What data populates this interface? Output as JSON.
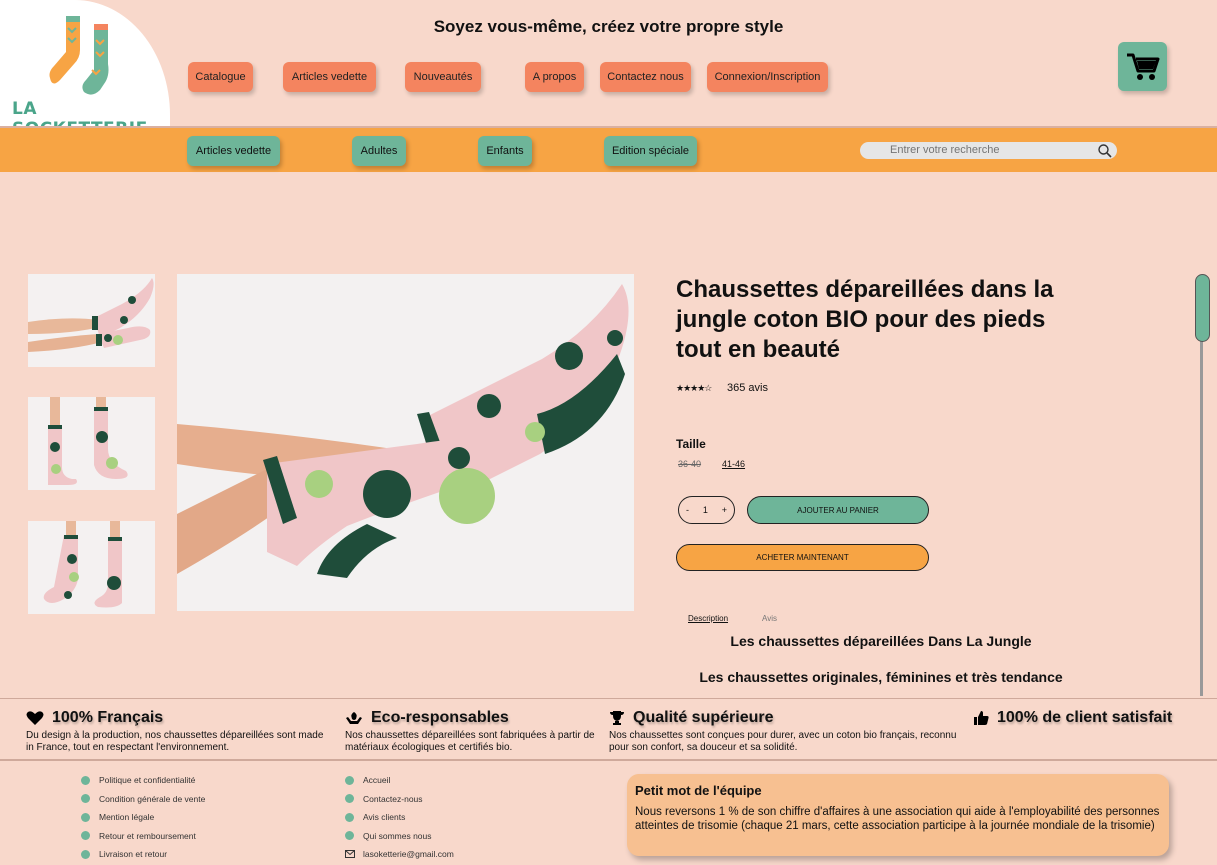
{
  "brand": {
    "name": "LA SOCKETTERIE"
  },
  "header": {
    "tagline": "Soyez vous-même, créez votre propre style",
    "nav": [
      "Catalogue",
      "Articles vedette",
      "Nouveautés",
      "A propos",
      "Contactez nous",
      "Connexion/Inscription"
    ],
    "cart_icon": "cart-icon"
  },
  "categories": [
    "Articles vedette",
    "Adultes",
    "Enfants",
    "Edition spéciale"
  ],
  "search": {
    "placeholder": "Entrer votre recherche"
  },
  "product": {
    "title": "Chaussettes dépareillées dans la jungle coton BIO pour des pieds tout en beauté",
    "rating_stars": "★★★★☆",
    "rating": 4,
    "reviews": "365 avis",
    "size_label": "Taille",
    "sizes": [
      "36-40",
      "41-46"
    ],
    "qty_minus": "-",
    "qty_value": "1",
    "qty_plus": "+",
    "add_to_cart": "AJOUTER  AU PANIER",
    "buy_now": "ACHETER MAINTENANT",
    "tabs": [
      "Description",
      "Avis"
    ],
    "desc_heading": "Les chaussettes dépareillées Dans La Jungle",
    "desc_text": "Les chaussettes originales, féminines et très tendance"
  },
  "features": [
    {
      "icon": "heart-icon",
      "title": "100% Français",
      "desc": "Du design à la production, nos chaussettes dépareillées sont made in France, tout en respectant l'environnement."
    },
    {
      "icon": "leaf-hands-icon",
      "title": "Eco-responsables",
      "desc": "Nos chaussettes dépareillées sont fabriquées à partir de matériaux écologiques et certifiés bio."
    },
    {
      "icon": "trophy-icon",
      "title": "Qualité supérieure",
      "desc": "Nos chaussettes sont conçues pour durer, avec un coton bio français, reconnu pour son confort, sa douceur et sa solidité."
    },
    {
      "icon": "thumbs-up-icon",
      "title": "100% de client satisfait",
      "desc": ""
    }
  ],
  "footer": {
    "legal": [
      "Politique et confidentialité",
      "Condition générale de vente",
      "Mention légale",
      "Retour et remboursement",
      "Livraison et retour"
    ],
    "links": [
      "Accueil",
      "Contactez-nous",
      "Avis clients",
      "Qui sommes nous"
    ],
    "email": "lasoketterie@gmail.com",
    "team_title": "Petit mot de l'équipe",
    "team_text": "Nous reversons 1 % de son chiffre d'affaires à une association qui aide à l'employabilité des personnes atteintes de trisomie (chaque 21 mars, cette association participe à la journée mondiale de la trisomie)"
  },
  "colors": {
    "background": "#f8d8cb",
    "orange": "#f7a444",
    "coral": "#f4845f",
    "green": "#6eb599",
    "team_box": "#f7c091"
  }
}
